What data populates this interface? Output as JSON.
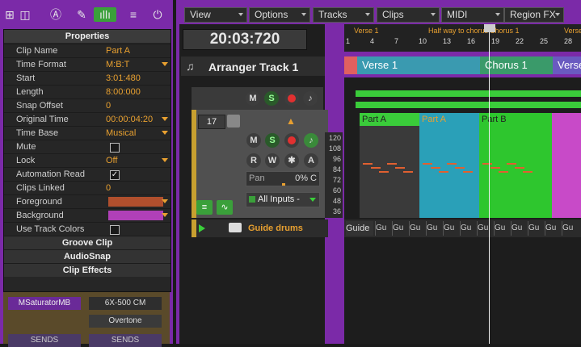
{
  "toolbar": {
    "icons": [
      "view-options-icon",
      "track-icon",
      "clip-icon",
      "brush-icon",
      "audio-icon",
      "list-icon",
      "power-icon"
    ]
  },
  "inspector": {
    "title": "Properties",
    "rows": [
      {
        "key": "Clip Name",
        "value": "Part A"
      },
      {
        "key": "Time Format",
        "value": "M:B:T",
        "dropdown": true
      },
      {
        "key": "Start",
        "value": "3:01:480"
      },
      {
        "key": "Length",
        "value": "8:00:000"
      },
      {
        "key": "Snap Offset",
        "value": "0"
      },
      {
        "key": "Original Time",
        "value": "00:00:04:20",
        "dropdown": true
      },
      {
        "key": "Time Base",
        "value": "Musical",
        "dropdown": true
      },
      {
        "key": "Mute",
        "checkbox": false
      },
      {
        "key": "Lock",
        "value": "Off",
        "dropdown": true
      },
      {
        "key": "Automation Read",
        "checkbox": true
      },
      {
        "key": "Clips Linked",
        "value": "0"
      },
      {
        "key": "Foreground",
        "color": "#b04f2d",
        "dropdown": true
      },
      {
        "key": "Background",
        "color": "#b040b8",
        "dropdown": true
      },
      {
        "key": "Use Track Colors",
        "checkbox": false
      }
    ],
    "sections": [
      "Groove Clip",
      "AudioSnap",
      "Clip Effects"
    ]
  },
  "fxrack": {
    "slot1": "MSaturatorMB",
    "slot2a": "6X-500 CM",
    "slot2b": "Overtone",
    "sends1": "SENDS",
    "sends2": "SENDS"
  },
  "menus": [
    "View",
    "Options",
    "Tracks",
    "Clips",
    "MIDI",
    "Region FX"
  ],
  "transport": {
    "time": "20:03:720"
  },
  "arranger": {
    "name": "Arranger Track 1",
    "sections": [
      {
        "label": "Verse 1",
        "color": "#3a9ab0"
      },
      {
        "label": "Chorus 1",
        "color": "#3a9a6a"
      },
      {
        "label": "Verse",
        "color": "#6a5ac0"
      }
    ]
  },
  "ruler": {
    "marks": [
      "1",
      "4",
      "7",
      "10",
      "13",
      "16",
      "19",
      "22",
      "25",
      "28"
    ],
    "markers": [
      "Verse 1",
      "Half way to chorus",
      "Chorus 1",
      "Verse"
    ]
  },
  "track": {
    "number": "17",
    "buttons": {
      "mute": "M",
      "solo": "S",
      "read": "R",
      "write": "W",
      "auto": "A"
    },
    "pan_label": "Pan",
    "pan_value": "0% C",
    "input": "All Inputs -",
    "scale": [
      "120",
      "108",
      "96",
      "84",
      "72",
      "60",
      "48",
      "36"
    ]
  },
  "top_track": {
    "buttons": {
      "mute": "M",
      "solo": "S"
    }
  },
  "clips": [
    {
      "label": "Part A",
      "color": "#3acc3a"
    },
    {
      "label": "Part A",
      "color": "#2aa0b8"
    },
    {
      "label": "Part B",
      "color": "#2ec62e"
    }
  ],
  "guide": {
    "name": "Guide drums",
    "clip_label": "Guide",
    "short_labels": "Gu"
  }
}
